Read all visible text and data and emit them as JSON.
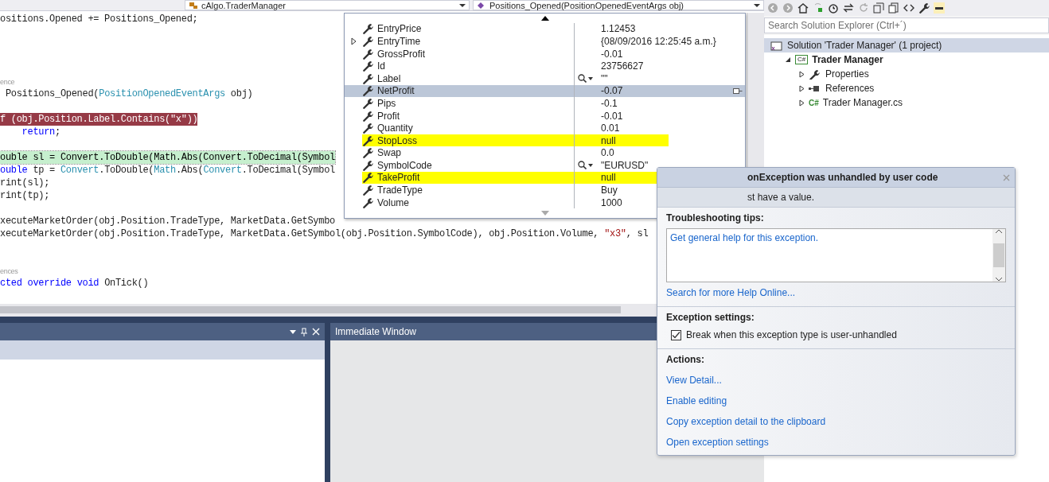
{
  "editor_nav": [
    {
      "text": "cAlgo.TraderManager"
    },
    {
      "text": "Positions_Opened(PositionOpenedEventArgs obj)"
    }
  ],
  "code_lines": [
    {
      "kind": "code",
      "tokens": [
        {
          "kind": "plain",
          "text": "ositions.Opened += Positions_Opened;"
        }
      ]
    },
    {
      "kind": "blank"
    },
    {
      "kind": "blank"
    },
    {
      "kind": "blank"
    },
    {
      "kind": "blank"
    },
    {
      "kind": "codelens",
      "text": "ence"
    },
    {
      "kind": "code",
      "tokens": [
        {
          "kind": "plain",
          "text": " Positions_Opened("
        },
        {
          "kind": "type",
          "text": "PositionOpenedEventArgs"
        },
        {
          "kind": "plain",
          "text": " obj)"
        }
      ]
    },
    {
      "kind": "blank"
    },
    {
      "kind": "breakpoint",
      "tokens": [
        {
          "kind": "plain",
          "text": "f (obj.Position.Label.Contains(\"x\"))"
        }
      ]
    },
    {
      "kind": "code",
      "tokens": [
        {
          "kind": "kw",
          "text": "    return"
        },
        {
          "kind": "plain",
          "text": ";"
        }
      ]
    },
    {
      "kind": "blank"
    },
    {
      "kind": "current",
      "tokens": [
        {
          "kind": "plain",
          "text": "ouble sl = Convert.ToDouble(Math.Abs(Convert.ToDecimal(Symbol"
        }
      ]
    },
    {
      "kind": "code",
      "tokens": [
        {
          "kind": "kw",
          "text": "ouble"
        },
        {
          "kind": "plain",
          "text": " tp = "
        },
        {
          "kind": "type",
          "text": "Convert"
        },
        {
          "kind": "plain",
          "text": ".ToDouble("
        },
        {
          "kind": "type",
          "text": "Math"
        },
        {
          "kind": "plain",
          "text": ".Abs("
        },
        {
          "kind": "type",
          "text": "Convert"
        },
        {
          "kind": "plain",
          "text": ".ToDecimal(Symbol"
        }
      ]
    },
    {
      "kind": "code",
      "tokens": [
        {
          "kind": "plain",
          "text": "rint(sl);"
        }
      ]
    },
    {
      "kind": "code",
      "tokens": [
        {
          "kind": "plain",
          "text": "rint(tp);"
        }
      ]
    },
    {
      "kind": "blank"
    },
    {
      "kind": "code",
      "tokens": [
        {
          "kind": "plain",
          "text": "xecuteMarketOrder(obj.Position.TradeType, MarketData.GetSymbo"
        }
      ]
    },
    {
      "kind": "code",
      "tokens": [
        {
          "kind": "plain",
          "text": "xecuteMarketOrder(obj.Position.TradeType, MarketData.GetSymbol(obj.Position.SymbolCode), obj.Position.Volume, "
        },
        {
          "kind": "str",
          "text": "\"x3\""
        },
        {
          "kind": "plain",
          "text": ", sl"
        }
      ]
    },
    {
      "kind": "blank"
    },
    {
      "kind": "blank"
    },
    {
      "kind": "codelens",
      "text": "ences"
    },
    {
      "kind": "code",
      "tokens": [
        {
          "kind": "kw",
          "text": "cted"
        },
        {
          "kind": "kw",
          "text": " override"
        },
        {
          "kind": "kw",
          "text": " void"
        },
        {
          "kind": "plain",
          "text": " OnTick()"
        }
      ]
    }
  ],
  "datatip": {
    "rows": [
      {
        "name": "EntryPrice",
        "value": "1.12453",
        "expandable": false,
        "visualizer": false,
        "selected": false,
        "highlighted": false
      },
      {
        "name": "EntryTime",
        "value": "{08/09/2016 12:25:45 a.m.}",
        "expandable": true,
        "visualizer": false,
        "selected": false,
        "highlighted": false
      },
      {
        "name": "GrossProfit",
        "value": "-0.01",
        "expandable": false,
        "visualizer": false,
        "selected": false,
        "highlighted": false
      },
      {
        "name": "Id",
        "value": "23756627",
        "expandable": false,
        "visualizer": false,
        "selected": false,
        "highlighted": false
      },
      {
        "name": "Label",
        "value": "\"\"",
        "expandable": false,
        "visualizer": true,
        "selected": false,
        "highlighted": false
      },
      {
        "name": "NetProfit",
        "value": "-0.07",
        "expandable": false,
        "visualizer": false,
        "selected": true,
        "highlighted": false
      },
      {
        "name": "Pips",
        "value": "-0.1",
        "expandable": false,
        "visualizer": false,
        "selected": false,
        "highlighted": false
      },
      {
        "name": "Profit",
        "value": "-0.01",
        "expandable": false,
        "visualizer": false,
        "selected": false,
        "highlighted": false
      },
      {
        "name": "Quantity",
        "value": "0.01",
        "expandable": false,
        "visualizer": false,
        "selected": false,
        "highlighted": false
      },
      {
        "name": "StopLoss",
        "value": "null",
        "expandable": false,
        "visualizer": false,
        "selected": false,
        "highlighted": true
      },
      {
        "name": "Swap",
        "value": "0.0",
        "expandable": false,
        "visualizer": false,
        "selected": false,
        "highlighted": false
      },
      {
        "name": "SymbolCode",
        "value": "\"EURUSD\"",
        "expandable": false,
        "visualizer": true,
        "selected": false,
        "highlighted": false
      },
      {
        "name": "TakeProfit",
        "value": "null",
        "expandable": false,
        "visualizer": false,
        "selected": false,
        "highlighted": true
      },
      {
        "name": "TradeType",
        "value": "Buy",
        "expandable": false,
        "visualizer": false,
        "selected": false,
        "highlighted": false
      },
      {
        "name": "Volume",
        "value": "1000",
        "expandable": false,
        "visualizer": false,
        "selected": false,
        "highlighted": false
      }
    ]
  },
  "immediate_window": {
    "title": "Immediate Window"
  },
  "solution_explorer": {
    "search": {
      "placeholder": "Search Solution Explorer (Ctrl+´)"
    },
    "tree": [
      {
        "kind": "solution",
        "label": "Solution 'Trader Manager' (1 project)",
        "selected": true,
        "bold": false,
        "children": [
          {
            "kind": "project",
            "icon_text": "C#",
            "label": "Trader Manager",
            "selected": false,
            "bold": true,
            "expanded": true,
            "children": [
              {
                "kind": "properties",
                "label": "Properties",
                "selected": false,
                "bold": false,
                "expanded": false
              },
              {
                "kind": "references",
                "label": "References",
                "selected": false,
                "bold": false,
                "expanded": false
              },
              {
                "kind": "file",
                "icon_text": "C#",
                "label": "Trader Manager.cs",
                "selected": false,
                "bold": false,
                "expanded": false
              }
            ]
          }
        ]
      }
    ]
  },
  "exception": {
    "title": "onException was unhandled by user code",
    "message": "st have a value.",
    "tips_heading": "Troubleshooting tips:",
    "tips": [
      "Get general help for this exception."
    ],
    "help_link": "Search for more Help Online...",
    "settings_heading": "Exception settings:",
    "setting": {
      "label": "Break when this exception type is user-unhandled",
      "checked": true
    },
    "actions_heading": "Actions:",
    "actions": [
      "View Detail...",
      "Enable editing",
      "Copy exception detail to the clipboard",
      "Open exception settings"
    ]
  }
}
